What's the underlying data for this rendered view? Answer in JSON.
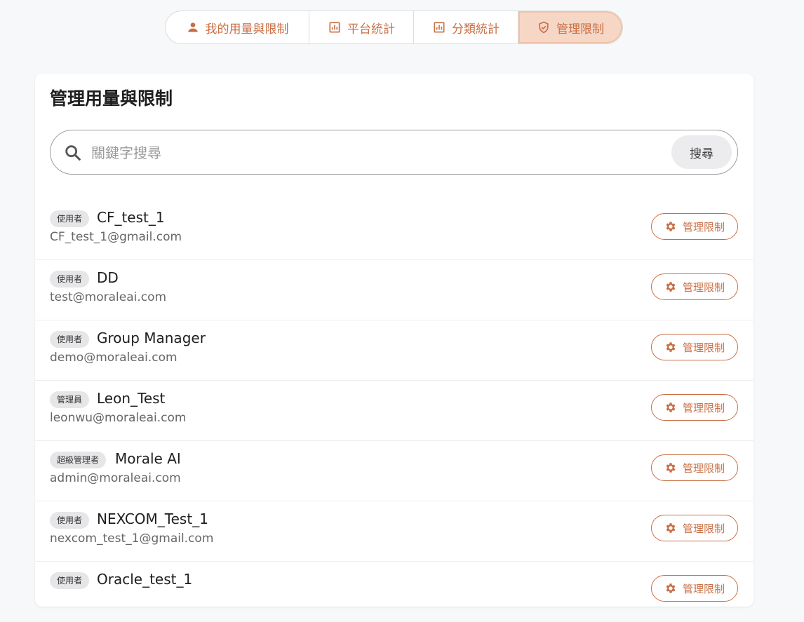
{
  "tabs": [
    {
      "label": "我的用量與限制",
      "icon": "person-icon"
    },
    {
      "label": "平台統計",
      "icon": "bar-chart-icon"
    },
    {
      "label": "分類統計",
      "icon": "bar-chart-icon"
    },
    {
      "label": "管理限制",
      "icon": "shield-check-icon",
      "active": true
    }
  ],
  "page": {
    "title": "管理用量與限制"
  },
  "search": {
    "placeholder": "關鍵字搜尋",
    "value": "",
    "button_label": "搜尋"
  },
  "users": [
    {
      "role": "使用者",
      "name": "CF_test_1",
      "email": "CF_test_1@gmail.com",
      "action": "管理限制"
    },
    {
      "role": "使用者",
      "name": "DD",
      "email": "test@moraleai.com",
      "action": "管理限制"
    },
    {
      "role": "使用者",
      "name": "Group Manager",
      "email": "demo@moraleai.com",
      "action": "管理限制"
    },
    {
      "role": "管理員",
      "name": "Leon_Test",
      "email": "leonwu@moraleai.com",
      "action": "管理限制"
    },
    {
      "role": "超級管理者",
      "name": "Morale AI",
      "email": "admin@moraleai.com",
      "action": "管理限制"
    },
    {
      "role": "使用者",
      "name": "NEXCOM_Test_1",
      "email": "nexcom_test_1@gmail.com",
      "action": "管理限制"
    },
    {
      "role": "使用者",
      "name": "Oracle_test_1",
      "email": "",
      "action": "管理限制"
    }
  ],
  "colors": {
    "accent": "#c96f45",
    "active_tab_bg": "#f6d7c6",
    "badge_bg": "#e6e6e8"
  }
}
